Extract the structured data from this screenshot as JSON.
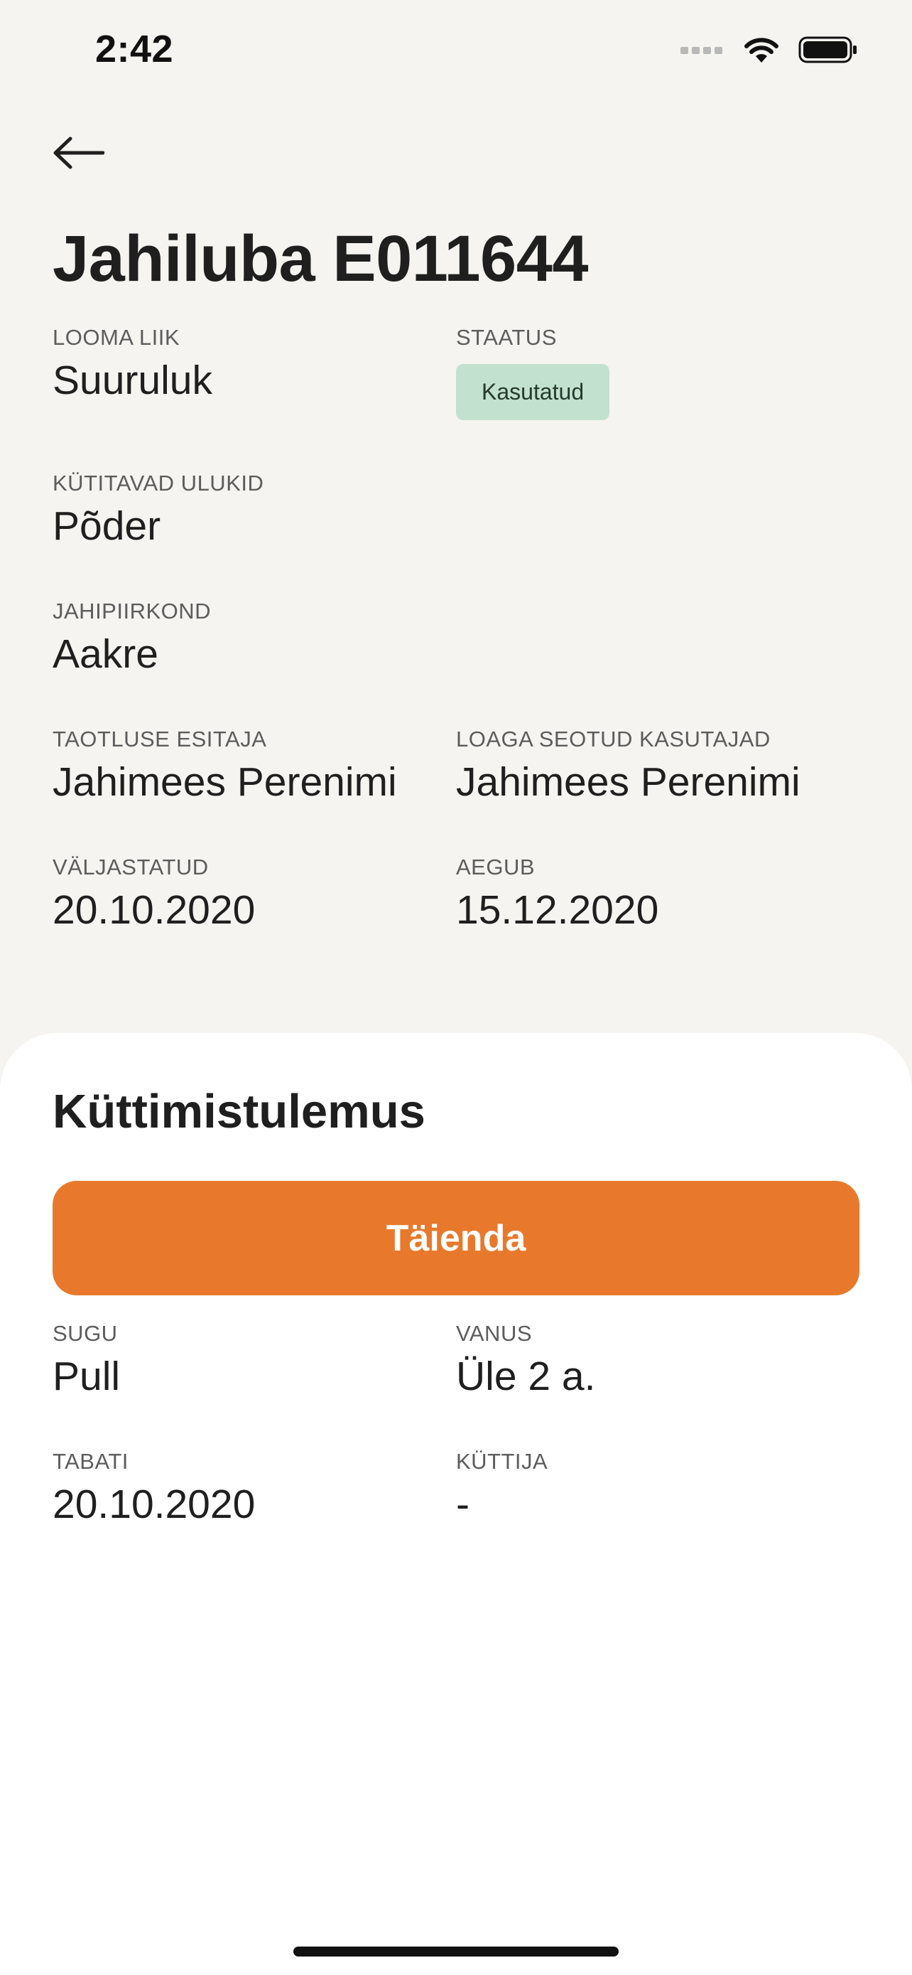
{
  "status_bar": {
    "time": "2:42",
    "icons": [
      "cellular-icon",
      "wifi-icon",
      "battery-icon"
    ]
  },
  "header": {
    "back_icon": "arrow-left-icon",
    "title": "Jahiluba E011644"
  },
  "details": {
    "animal_type": {
      "label": "LOOMA LIIK",
      "value": "Suuruluk"
    },
    "status": {
      "label": "STAATUS",
      "value": "Kasutatud",
      "badge_color": "#c3e1cf"
    },
    "game_species": {
      "label": "KÜTITAVAD ULUKID",
      "value": "Põder"
    },
    "hunting_district": {
      "label": "JAHIPIIRKOND",
      "value": "Aakre"
    },
    "applicant": {
      "label": "TAOTLUSE ESITAJA",
      "value": "Jahimees Perenimi"
    },
    "linked_users": {
      "label": "LOAGA SEOTUD KASUTAJAD",
      "value": "Jahimees Perenimi"
    },
    "issued": {
      "label": "VÄLJASTATUD",
      "value": "20.10.2020"
    },
    "expires": {
      "label": "AEGUB",
      "value": "15.12.2020"
    }
  },
  "result": {
    "title": "Küttimistulemus",
    "complete_button": "Täienda",
    "button_color": "#e8792c",
    "sex": {
      "label": "SUGU",
      "value": "Pull"
    },
    "age": {
      "label": "VANUS",
      "value": "Üle 2 a."
    },
    "killed": {
      "label": "TABATI",
      "value": "20.10.2020"
    },
    "hunter": {
      "label": "KÜTTIJA",
      "value": "-"
    }
  }
}
